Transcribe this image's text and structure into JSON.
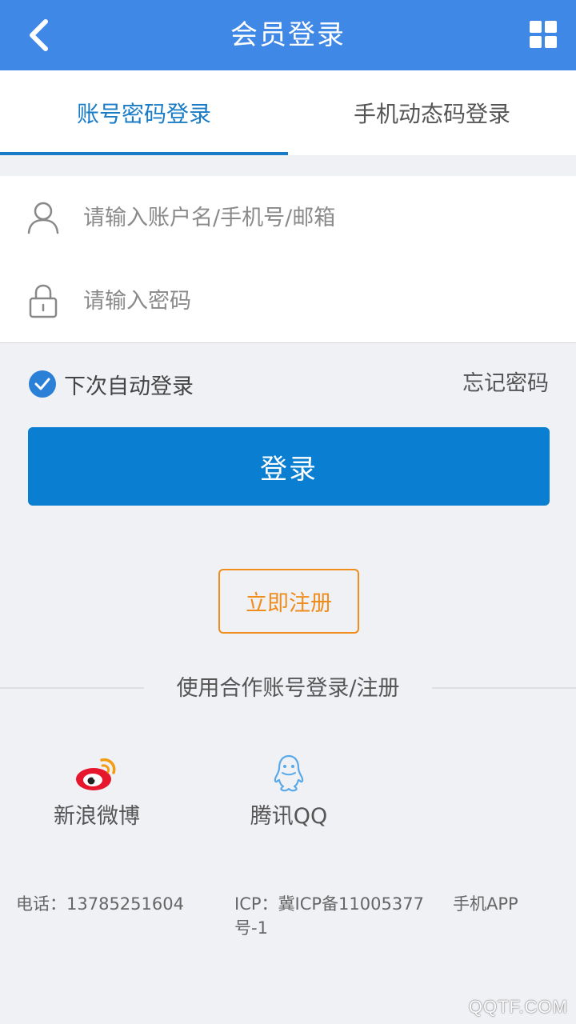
{
  "header": {
    "title": "会员登录",
    "back_icon": "chevron-left-icon",
    "menu_icon": "grid-icon"
  },
  "tabs": [
    {
      "label": "账号密码登录",
      "active": true
    },
    {
      "label": "手机动态码登录",
      "active": false
    }
  ],
  "form": {
    "username_placeholder": "请输入账户名/手机号/邮箱",
    "username_value": "",
    "password_placeholder": "请输入密码",
    "password_value": "",
    "remember_label": "下次自动登录",
    "remember_checked": true,
    "forgot_label": "忘记密码",
    "login_label": "登录",
    "register_label": "立即注册"
  },
  "partners": {
    "title": "使用合作账号登录/注册",
    "items": [
      {
        "label": "新浪微博",
        "icon": "weibo-icon"
      },
      {
        "label": "腾讯QQ",
        "icon": "qq-icon"
      }
    ]
  },
  "footer": {
    "phone": "电话：13785251604",
    "icp_line1": "ICP：冀ICP备11005377",
    "icp_line2": "号-1",
    "app": "手机APP"
  },
  "watermark": "QQTF.COM",
  "colors": {
    "header_bg": "#3f88e6",
    "accent": "#1a7cc6",
    "login_button": "#0a7fd2",
    "register_border": "#f08c1c"
  }
}
